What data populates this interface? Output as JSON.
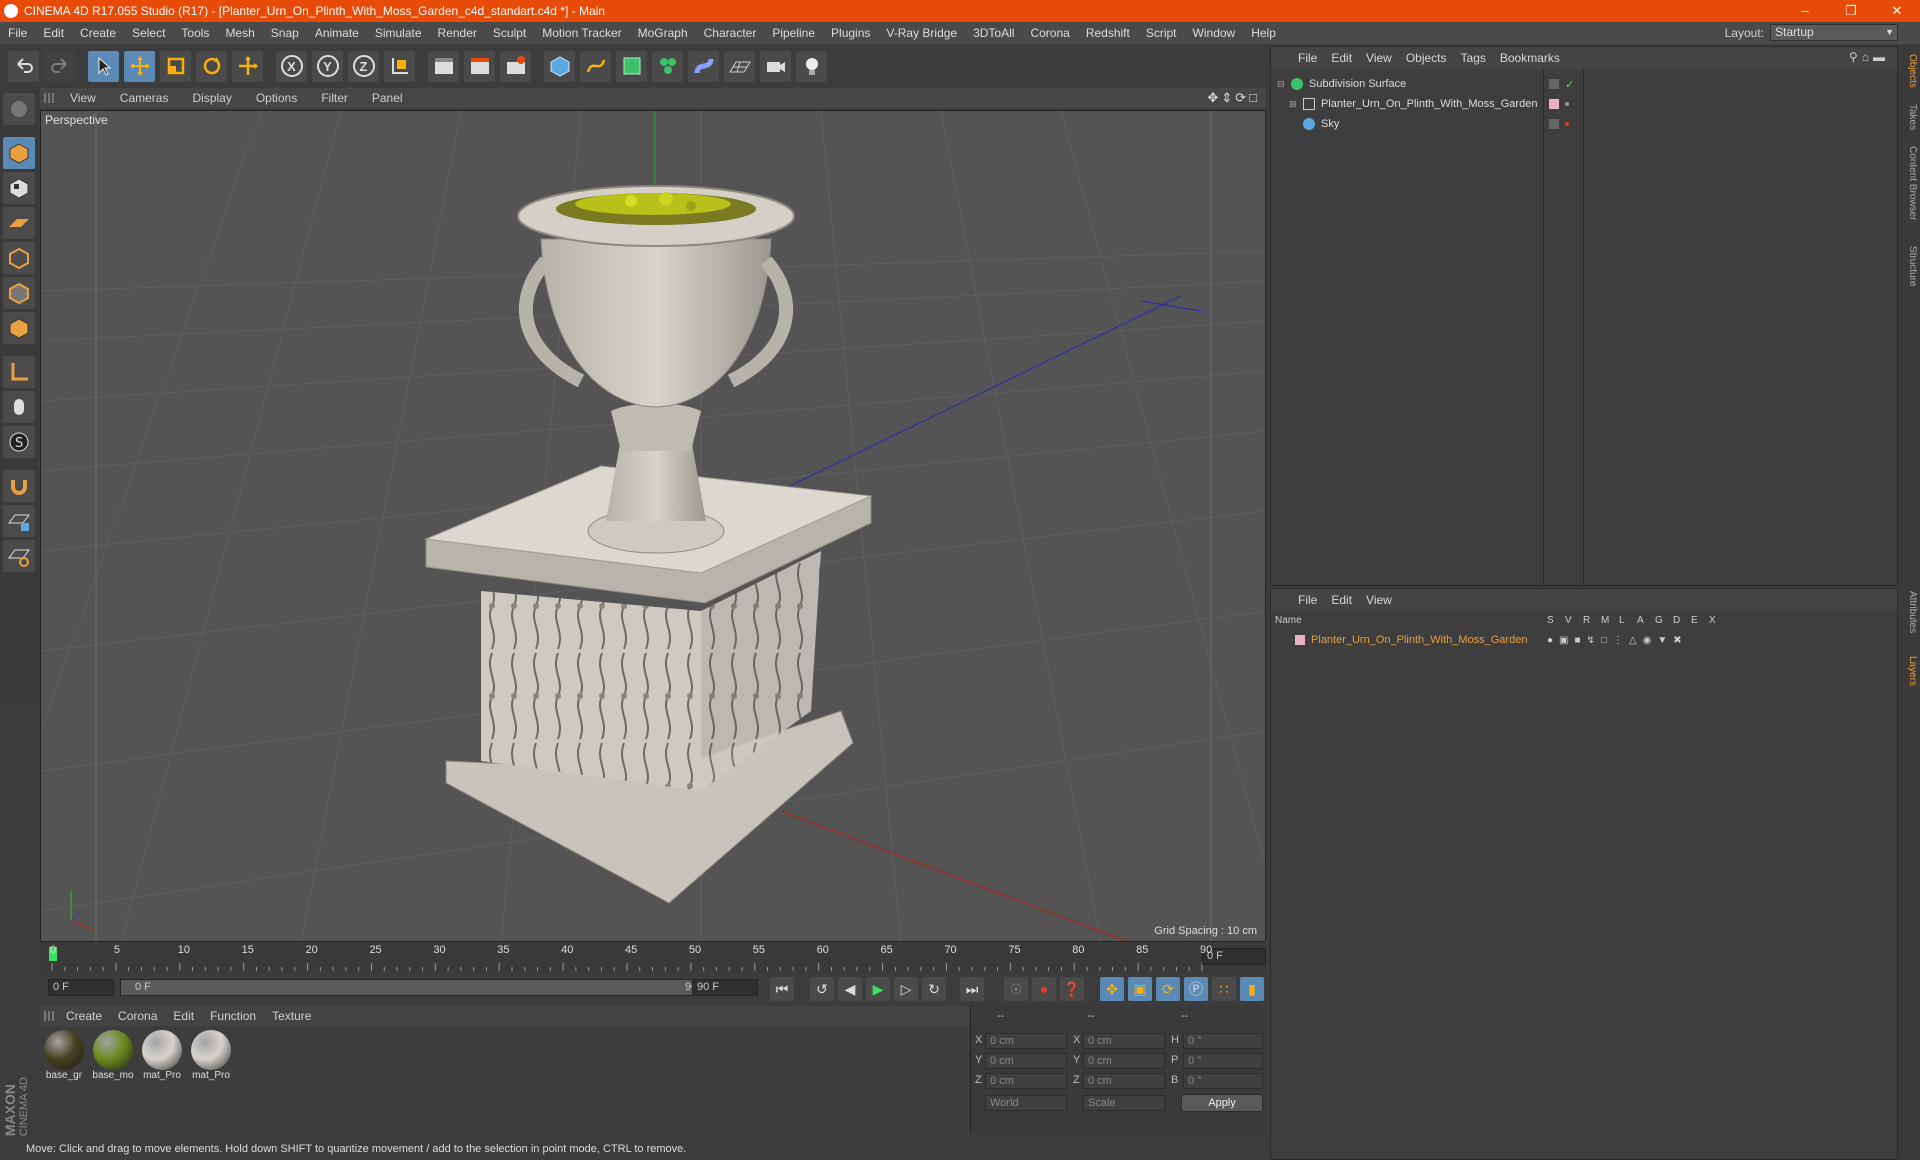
{
  "window": {
    "title": "CINEMA 4D R17.055 Studio (R17) - [Planter_Urn_On_Plinth_With_Moss_Garden_c4d_standart.c4d *] - Main"
  },
  "menubar": [
    "File",
    "Edit",
    "Create",
    "Select",
    "Tools",
    "Mesh",
    "Snap",
    "Animate",
    "Simulate",
    "Render",
    "Sculpt",
    "Motion Tracker",
    "MoGraph",
    "Character",
    "Pipeline",
    "Plugins",
    "V-Ray Bridge",
    "3DToAll",
    "Corona",
    "Redshift",
    "Script",
    "Window",
    "Help"
  ],
  "layout": {
    "label": "Layout:",
    "value": "Startup"
  },
  "toolbar": {
    "x_label": "X",
    "y_label": "Y",
    "z_label": "Z"
  },
  "viewport": {
    "menu": [
      "View",
      "Cameras",
      "Display",
      "Options",
      "Filter",
      "Panel"
    ],
    "label": "Perspective",
    "grid_spacing": "Grid Spacing : 10 cm"
  },
  "timeline": {
    "ticks": [
      "0",
      "5",
      "10",
      "15",
      "20",
      "25",
      "30",
      "35",
      "40",
      "45",
      "50",
      "55",
      "60",
      "65",
      "70",
      "75",
      "80",
      "85",
      "90"
    ],
    "current_frame": "0 F",
    "start": "0 F",
    "range_start": "0 F",
    "range_end": "90 F",
    "end": "90 F"
  },
  "materials": {
    "menu": [
      "Create",
      "Corona",
      "Edit",
      "Function",
      "Texture"
    ],
    "items": [
      {
        "label": "base_gr",
        "color": "#4a4020"
      },
      {
        "label": "base_mo",
        "color": "#6b8a1f"
      },
      {
        "label": "mat_Pro",
        "color": "#d8d4cc"
      },
      {
        "label": "mat_Pro",
        "color": "#d8d4cc"
      }
    ]
  },
  "coordinates": {
    "headers": [
      "--",
      "--",
      "--"
    ],
    "rows": [
      {
        "a": "X",
        "av": "0 cm",
        "b": "X",
        "bv": "0 cm",
        "c": "H",
        "cv": "0 °"
      },
      {
        "a": "Y",
        "av": "0 cm",
        "b": "Y",
        "bv": "0 cm",
        "c": "P",
        "cv": "0 °"
      },
      {
        "a": "Z",
        "av": "0 cm",
        "b": "Z",
        "bv": "0 cm",
        "c": "B",
        "cv": "0 °"
      }
    ],
    "mode": "World",
    "scale": "Scale",
    "apply": "Apply"
  },
  "object_manager": {
    "menu": [
      "File",
      "Edit",
      "View",
      "Objects",
      "Tags",
      "Bookmarks"
    ],
    "objects": [
      "Subdivision Surface",
      "Planter_Urn_On_Plinth_With_Moss_Garden",
      "Sky"
    ]
  },
  "layer_manager": {
    "menu": [
      "File",
      "Edit",
      "View"
    ],
    "name_header": "Name",
    "columns": [
      "S",
      "V",
      "R",
      "M",
      "L",
      "A",
      "G",
      "D",
      "E",
      "X"
    ],
    "layers": [
      {
        "name": "Planter_Urn_On_Plinth_With_Moss_Garden",
        "color": "#e8a040"
      }
    ]
  },
  "right_tabs": [
    "Objects",
    "Takes",
    "Content Browser",
    "Structure",
    "Attributes",
    "Layers"
  ],
  "brand": {
    "line1": "MAXON",
    "line2": "CINEMA 4D"
  },
  "status": "Move: Click and drag to move elements. Hold down SHIFT to quantize movement / add to the selection in point mode, CTRL to remove."
}
